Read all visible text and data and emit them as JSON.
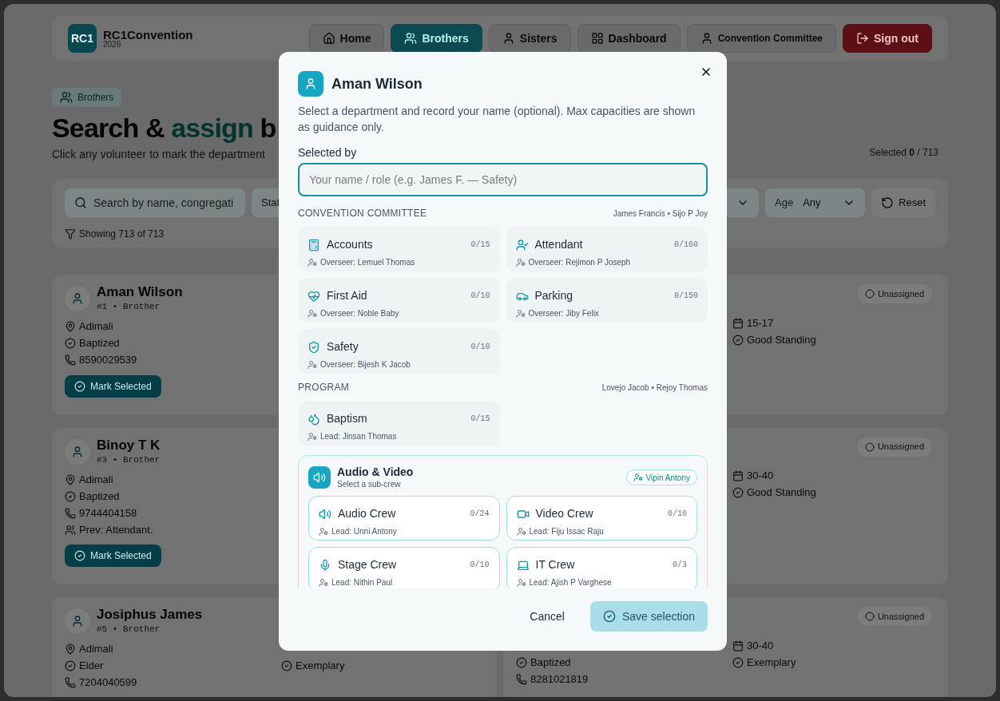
{
  "header": {
    "logo": "RC1",
    "app_name": "RC1Convention",
    "year": "2026",
    "nav": [
      {
        "label": "Home",
        "selected": false,
        "kind": "link"
      },
      {
        "label": "Brothers",
        "selected": true,
        "kind": "link"
      },
      {
        "label": "Sisters",
        "selected": false,
        "kind": "link"
      },
      {
        "label": "Dashboard",
        "selected": false,
        "kind": "link"
      },
      {
        "label": "Convention Committee",
        "selected": false,
        "kind": "small"
      },
      {
        "label": "Sign out",
        "selected": false,
        "kind": "danger"
      }
    ]
  },
  "page": {
    "badge": "Brothers",
    "title": {
      "before": "Search &",
      "highlight": "assign",
      "after": "b"
    },
    "subtitle": "Click any volunteer to mark the department",
    "selected_count": "Selected **0** / 713",
    "filters": {
      "search_placeholder": "Search by name, congregati",
      "status_label": "Stat",
      "age_label": "Age",
      "age_value": "Any",
      "reset": "Reset",
      "showing": "Showing 713 of 713"
    },
    "rows": [
      {
        "left": {
          "name": "Aman Wilson",
          "meta": "#1 • Brother",
          "details": [
            {
              "kind": "place",
              "text": "Adimali"
            },
            {
              "kind": "status",
              "text": "Baptized"
            },
            {
              "kind": "phone",
              "text": "8590029539"
            }
          ],
          "button": "Mark Selected"
        },
        "right": {
          "badge": "Unassigned",
          "extra": [
            {
              "kind": "age",
              "text": "15-17"
            },
            {
              "kind": "status",
              "text": "Good Standing"
            }
          ]
        }
      },
      {
        "left": {
          "name": "Binoy T K",
          "meta": "#3 • Brother",
          "details": [
            {
              "kind": "place",
              "text": "Adimali"
            },
            {
              "kind": "status",
              "text": "Baptized"
            },
            {
              "kind": "phone",
              "text": "9744404158"
            },
            {
              "kind": "history",
              "text": "Prev: Attendant."
            }
          ],
          "button": "Mark Selected"
        },
        "right": {
          "badge": "Unassigned",
          "extra": [
            {
              "kind": "age",
              "text": "30-40"
            },
            {
              "kind": "status",
              "text": "Good Standing"
            }
          ]
        }
      },
      {
        "left": {
          "name": "Josiphus James",
          "meta": "#5 • Brother",
          "details": [
            {
              "kind": "place",
              "text": "Adimali"
            },
            {
              "kind": "status",
              "text": "Elder"
            },
            {
              "kind": "phone",
              "text": "7204040599"
            }
          ],
          "extra": [
            {
              "kind": "status",
              "text": "Exemplary"
            }
          ]
        },
        "right": {
          "badge": "Unassigned",
          "details": [
            {
              "kind": "status",
              "text": "Baptized"
            },
            {
              "kind": "phone",
              "text": "8281021819"
            }
          ],
          "extra": [
            {
              "kind": "age",
              "text": "30-40"
            },
            {
              "kind": "status",
              "text": "Exemplary"
            }
          ]
        }
      }
    ]
  },
  "dialog": {
    "title": "Aman Wilson",
    "description": "Select a department and record your name (optional). Max capacities are shown as guidance only.",
    "field_label": "Selected by",
    "field_placeholder": "Your name / role (e.g. James F. — Safety)",
    "sections": [
      {
        "title": "CONVENTION COMMITTEE",
        "leads": "James Francis • Sijo P Joy",
        "items": [
          {
            "name": "Accounts",
            "count": "0/15",
            "person": "Overseer: Lemuel Thomas",
            "kind": "accounts",
            "selected": false
          },
          {
            "name": "Attendant",
            "count": "0/160",
            "person": "Overseer: Rejimon P Joseph",
            "kind": "attendant",
            "selected": false
          },
          {
            "name": "First Aid",
            "count": "0/10",
            "person": "Overseer: Noble Baby",
            "kind": "medical",
            "selected": false
          },
          {
            "name": "Parking",
            "count": "0/150",
            "person": "Overseer: Jiby Felix",
            "kind": "parking",
            "selected": false
          },
          {
            "name": "Safety",
            "count": "0/10",
            "person": "Overseer: Bijesh K Jacob",
            "kind": "safety",
            "selected": false
          }
        ]
      },
      {
        "title": "PROGRAM",
        "leads": "Lovejo Jacob • Rejoy Thomas",
        "items": [
          {
            "name": "Baptism",
            "count": "0/15",
            "person": "Lead: Jinsan Thomas",
            "kind": "baptism",
            "selected": false
          }
        ]
      }
    ],
    "group": {
      "title": "Audio & Video",
      "subtitle": "Select a sub-crew",
      "lead": "Vipin Antony",
      "items": [
        {
          "name": "Audio Crew",
          "count": "0/24",
          "person": "Lead: Unni Antony",
          "kind": "audio",
          "selected": false
        },
        {
          "name": "Video Crew",
          "count": "0/10",
          "person": "Lead: Fiju Issac Raju",
          "kind": "video",
          "selected": false
        },
        {
          "name": "Stage Crew",
          "count": "0/10",
          "person": "Lead: Nithin Paul",
          "kind": "stage",
          "selected": false
        },
        {
          "name": "IT Crew",
          "count": "0/3",
          "person": "Lead: Ajish P Varghese",
          "kind": "it",
          "selected": false
        }
      ]
    },
    "cancel": "Cancel",
    "save": "Save selection",
    "save_disabled": true
  }
}
